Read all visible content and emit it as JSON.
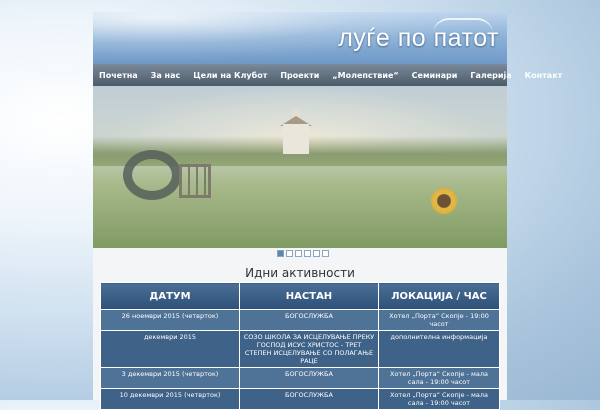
{
  "header": {
    "logo_text": "луѓе по патот"
  },
  "nav": {
    "items": [
      "Почетна",
      "За нас",
      "Цели на Клубот",
      "Проекти",
      "„Молепствие“",
      "Семинари",
      "Галерија",
      "Контакт"
    ]
  },
  "slider": {
    "dot_count": 6,
    "active_index": 0
  },
  "events": {
    "title": "Идни активности",
    "columns": [
      "ДАТУМ",
      "НАСТАН",
      "ЛОКАЦИЈА / ЧАС"
    ],
    "rows": [
      [
        "26 ноември 2015 (четврток)",
        "БОГОСЛУЖБА",
        "Хотел „Порта“ Скопје - 19:00 часот"
      ],
      [
        "декември 2015",
        "СОЗО ШКОЛА ЗА ИСЦЕЛУВАЊЕ ПРЕКУ ГОСПОД ИСУС ХРИСТОС - ТРЕТ СТЕПЕН ИСЦЕЛУВАЊЕ СО ПОЛАГАЊЕ РАЦЕ",
        "дополнителна информација"
      ],
      [
        "3 декември 2015 (четврток)",
        "БОГОСЛУЖБА",
        "Хотел „Порта“ Скопје - мала сала - 19:00 часот"
      ],
      [
        "10 декември 2015 (четврток)",
        "БОГОСЛУЖБА",
        "Хотел „Порта“ Скопје - мала сала - 19:00 часот"
      ]
    ]
  }
}
